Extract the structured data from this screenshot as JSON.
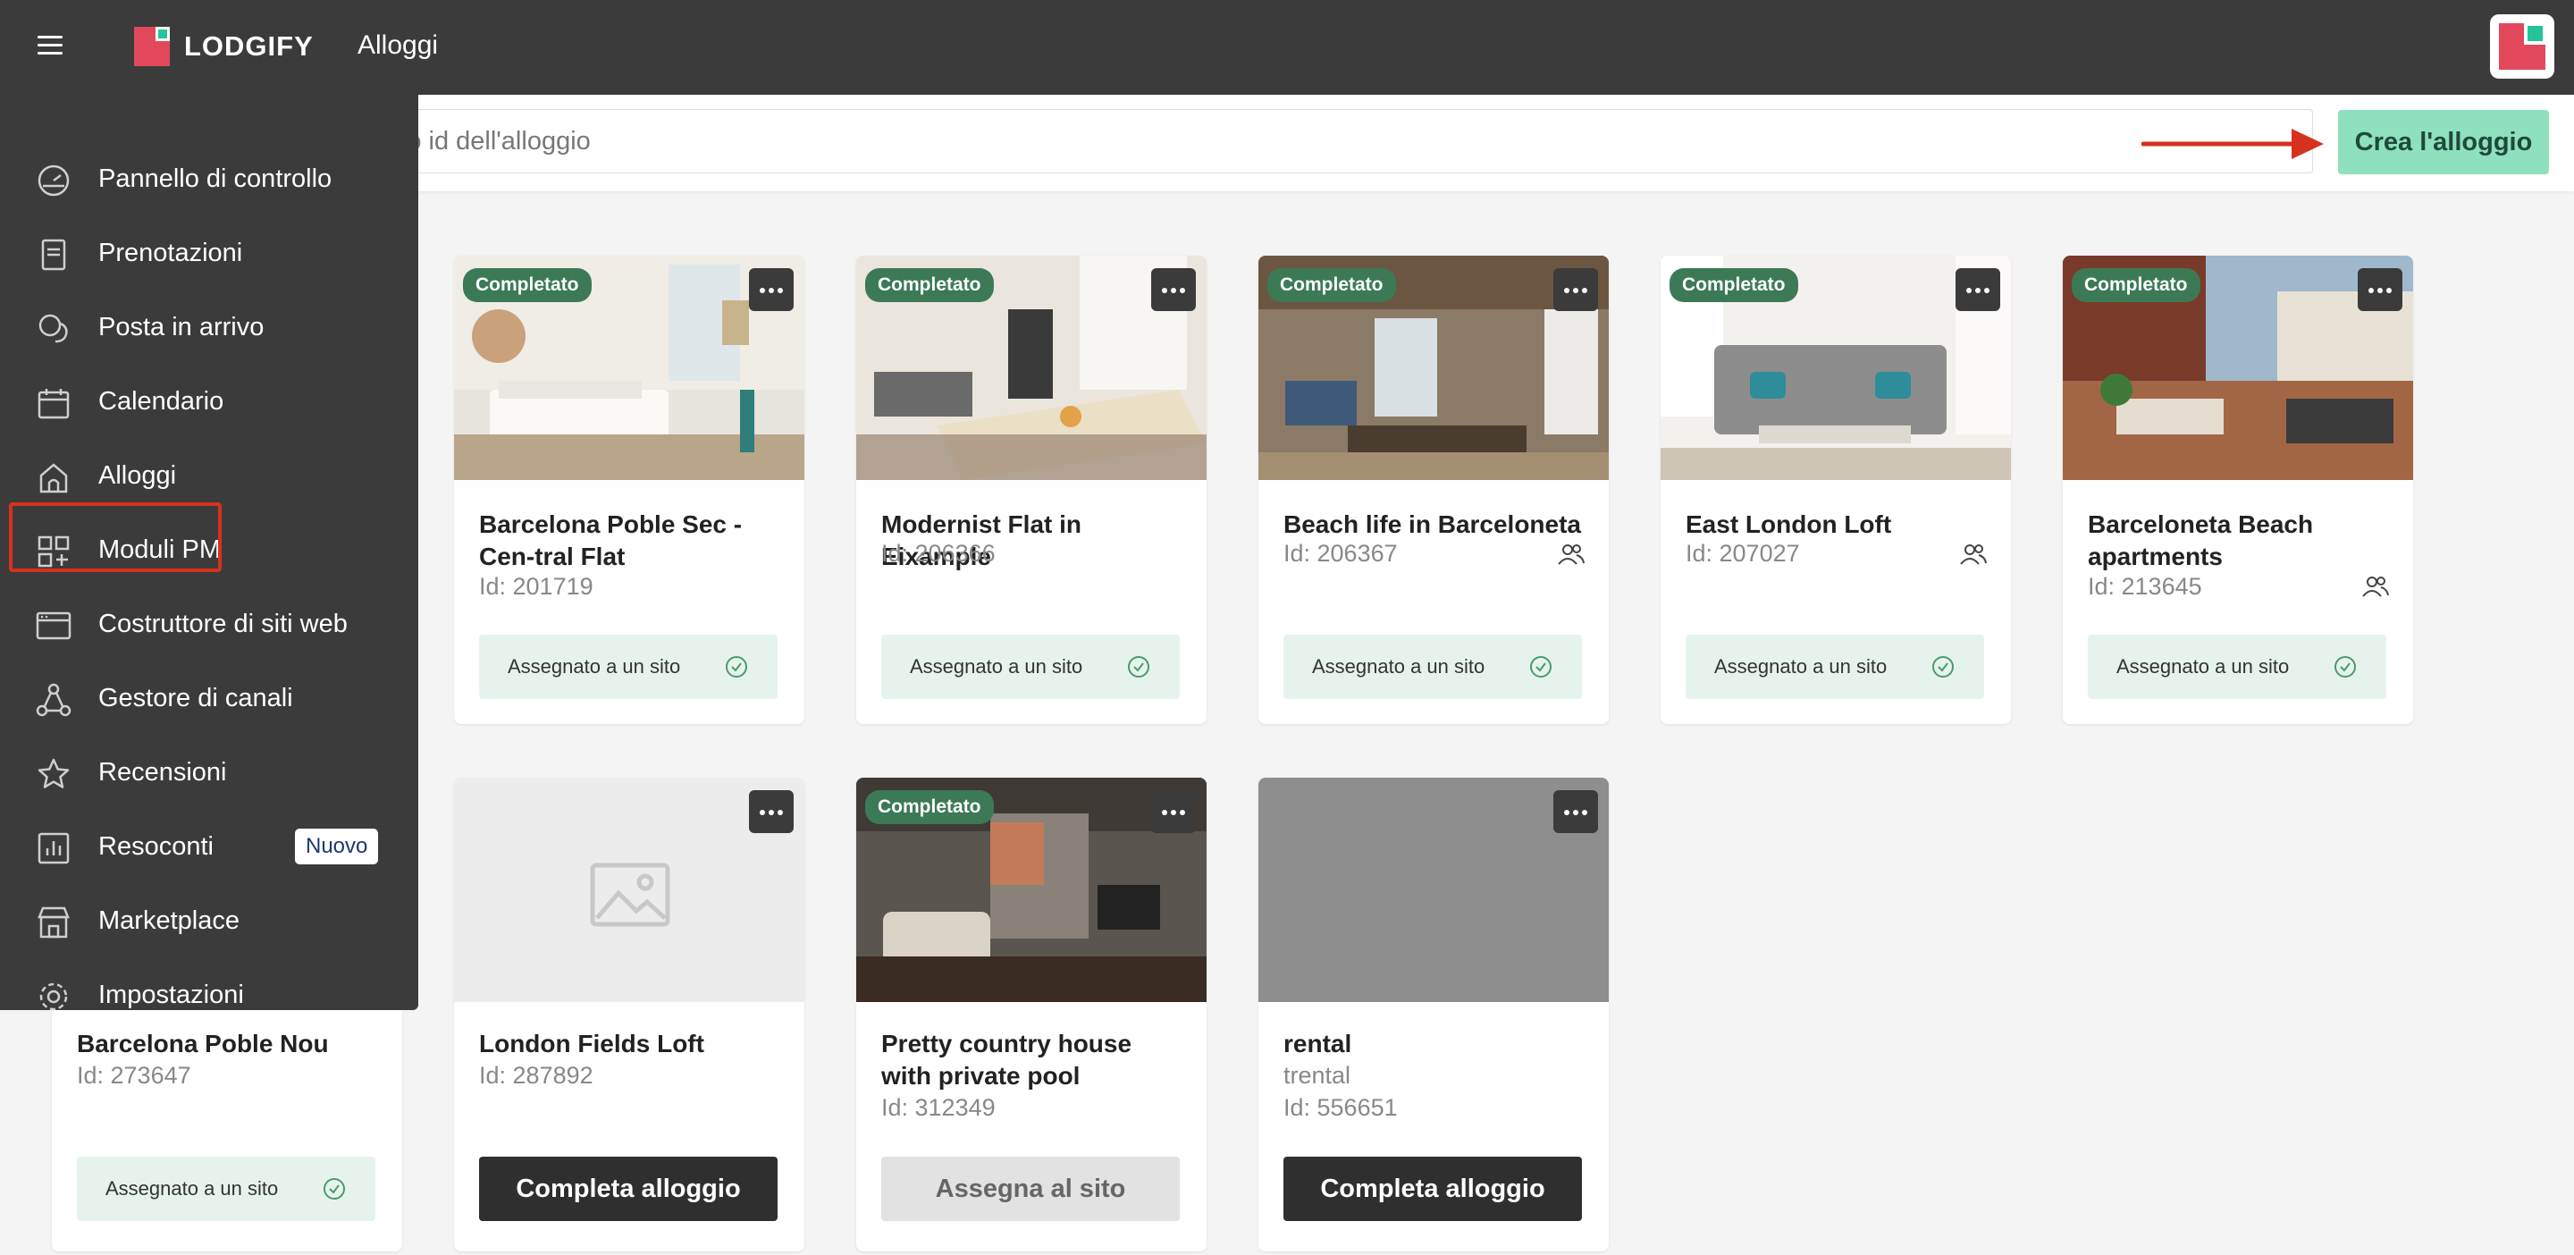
{
  "header": {
    "brand": "LODGIFY",
    "page_title": "Alloggi"
  },
  "search": {
    "placeholder": "ne o id dell'alloggio"
  },
  "create_button": "Crea l'alloggio",
  "sidebar": {
    "items": [
      {
        "label": "Pannello di controllo",
        "icon": "dashboard-icon"
      },
      {
        "label": "Prenotazioni",
        "icon": "book-icon"
      },
      {
        "label": "Posta in arrivo",
        "icon": "chat-icon"
      },
      {
        "label": "Calendario",
        "icon": "calendar-icon"
      },
      {
        "label": "Alloggi",
        "icon": "home-icon"
      },
      {
        "label": "Moduli PM",
        "icon": "modules-icon"
      },
      {
        "label": "Costruttore di siti web",
        "icon": "browser-icon"
      },
      {
        "label": "Gestore di canali",
        "icon": "channels-icon"
      },
      {
        "label": "Recensioni",
        "icon": "star-icon"
      },
      {
        "label": "Resoconti",
        "icon": "bar-chart-icon",
        "badge": "Nuovo"
      },
      {
        "label": "Marketplace",
        "icon": "store-icon"
      },
      {
        "label": "Impostazioni",
        "icon": "gear-icon"
      }
    ],
    "active": "Alloggi"
  },
  "properties": [
    {
      "status": "Completato",
      "title": "Barcelona Poble Sec - Cen-tral Flat",
      "id": "Id: 201719",
      "action": "Assegnato a un sito",
      "shared": false
    },
    {
      "status": "Completato",
      "title": "Modernist Flat in Eixample",
      "id": "Id: 206366",
      "action": "Assegnato a un sito",
      "shared": false
    },
    {
      "status": "Completato",
      "title": "Beach life in Barceloneta",
      "id": "Id: 206367",
      "action": "Assegnato a un sito",
      "shared": true
    },
    {
      "status": "Completato",
      "title": "East London Loft",
      "id": "Id: 207027",
      "action": "Assegnato a un sito",
      "shared": true
    },
    {
      "status": "Completato",
      "title": "Barceloneta Beach apartments",
      "id": "Id: 213645",
      "action": "Assegnato a un sito",
      "shared": true
    },
    {
      "status": "",
      "title": "Barcelona Poble Nou",
      "id": "Id: 273647",
      "action": "Assegnato a un sito",
      "shared": false
    },
    {
      "status": "",
      "title": "London Fields Loft",
      "id": "Id: 287892",
      "action": "Completa alloggio",
      "shared": false
    },
    {
      "status": "Completato",
      "title": "Pretty country house with private pool",
      "id": "Id: 312349",
      "action": "Assegna al sito",
      "shared": false
    },
    {
      "status": "",
      "title": "rental",
      "subtitle": "trental",
      "id": "Id: 556651",
      "action": "Completa alloggio",
      "shared": false
    }
  ],
  "colors": {
    "topbar": "#3b3b3b",
    "brand_red": "#e2485b",
    "brand_green": "#23c49a",
    "create_button": "#8ee0bf",
    "status_badge": "#3c7a56",
    "assigned_bg": "#e6f3ec",
    "highlight_red": "#d6311e"
  }
}
